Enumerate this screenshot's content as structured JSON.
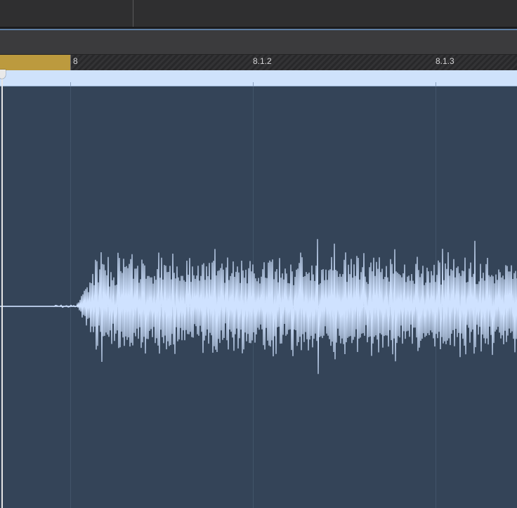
{
  "ruler": {
    "markers": [
      {
        "label": "8"
      },
      {
        "label": "8.1.2"
      },
      {
        "label": "8.1.3"
      }
    ]
  },
  "colors": {
    "cycle_region": "#bc9a3e",
    "region_background": "#344458",
    "region_header": "#cfe2fb",
    "waveform": "#cfe2ff",
    "playhead": "#e6e6e6"
  },
  "icons": {
    "playhead": "playhead-handle-icon"
  }
}
